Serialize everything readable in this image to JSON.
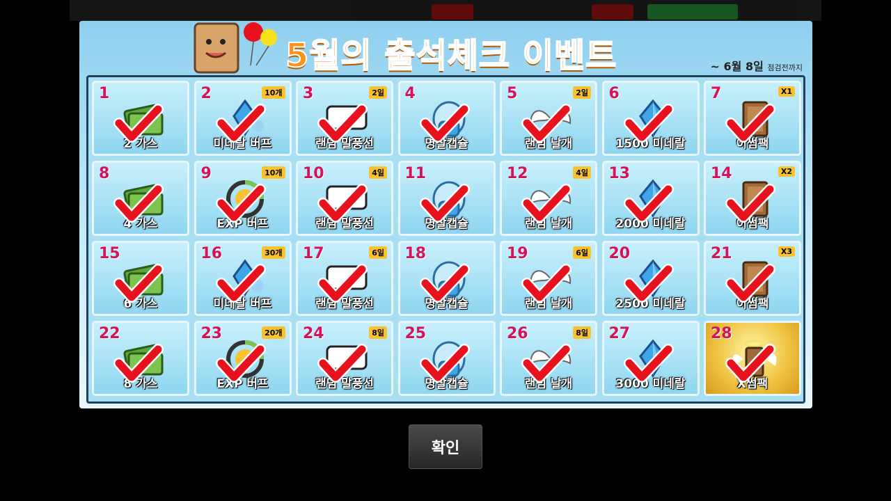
{
  "event": {
    "title": "5월의 출석체크 이벤트",
    "date": "~ 6월 8일",
    "date_suffix": "점검전까지"
  },
  "confirm_label": "확인",
  "colors": {
    "title": "#f7931e",
    "check": "#e8121f",
    "day_number": "#d4145a"
  },
  "days": [
    {
      "day": "1",
      "label": "2 가스",
      "icon": "cash-icon",
      "badge": "",
      "checked": true
    },
    {
      "day": "2",
      "label": "미네랄 버프",
      "icon": "mineral-buff-icon",
      "badge": "10개",
      "checked": true
    },
    {
      "day": "3",
      "label": "랜덤 말풍선",
      "icon": "speech-bubble-icon",
      "badge": "2일",
      "checked": true
    },
    {
      "day": "4",
      "label": "명찰캡슐",
      "icon": "capsule-icon",
      "badge": "",
      "checked": true
    },
    {
      "day": "5",
      "label": "랜덤 날개",
      "icon": "wings-icon",
      "badge": "2일",
      "checked": true
    },
    {
      "day": "6",
      "label": "1500 미네랄",
      "icon": "mineral-icon",
      "badge": "",
      "checked": true
    },
    {
      "day": "7",
      "label": "이썸팩",
      "icon": "pack-icon",
      "badge": "X1",
      "checked": true
    },
    {
      "day": "8",
      "label": "4 가스",
      "icon": "cash-icon",
      "badge": "",
      "checked": true
    },
    {
      "day": "9",
      "label": "EXP 버프",
      "icon": "exp-buff-icon",
      "badge": "10개",
      "checked": true
    },
    {
      "day": "10",
      "label": "랜덤 말풍선",
      "icon": "speech-bubble-icon",
      "badge": "4일",
      "checked": true
    },
    {
      "day": "11",
      "label": "명찰캡슐",
      "icon": "capsule-icon",
      "badge": "",
      "checked": true
    },
    {
      "day": "12",
      "label": "랜덤 날개",
      "icon": "wings-icon",
      "badge": "4일",
      "checked": true
    },
    {
      "day": "13",
      "label": "2000 미네랄",
      "icon": "mineral-icon",
      "badge": "",
      "checked": true
    },
    {
      "day": "14",
      "label": "이썸팩",
      "icon": "pack-icon",
      "badge": "X2",
      "checked": true
    },
    {
      "day": "15",
      "label": "6 가스",
      "icon": "cash-icon",
      "badge": "",
      "checked": true
    },
    {
      "day": "16",
      "label": "미네랄 버프",
      "icon": "mineral-buff-icon",
      "badge": "30개",
      "checked": true
    },
    {
      "day": "17",
      "label": "랜덤 말풍선",
      "icon": "speech-bubble-icon",
      "badge": "6일",
      "checked": true
    },
    {
      "day": "18",
      "label": "명찰캡슐",
      "icon": "capsule-icon",
      "badge": "",
      "checked": true
    },
    {
      "day": "19",
      "label": "랜덤 날개",
      "icon": "wings-icon",
      "badge": "6일",
      "checked": true
    },
    {
      "day": "20",
      "label": "2500 미네랄",
      "icon": "mineral-icon",
      "badge": "",
      "checked": true
    },
    {
      "day": "21",
      "label": "이썸팩",
      "icon": "pack-icon",
      "badge": "X3",
      "checked": true
    },
    {
      "day": "22",
      "label": "8 가스",
      "icon": "cash-icon",
      "badge": "",
      "checked": true
    },
    {
      "day": "23",
      "label": "EXP 버프",
      "icon": "exp-buff-icon",
      "badge": "20개",
      "checked": true
    },
    {
      "day": "24",
      "label": "랜덤 말풍선",
      "icon": "speech-bubble-icon",
      "badge": "8일",
      "checked": true
    },
    {
      "day": "25",
      "label": "명찰캡슐",
      "icon": "capsule-icon",
      "badge": "",
      "checked": true
    },
    {
      "day": "26",
      "label": "랜덤 날개",
      "icon": "wings-icon",
      "badge": "8일",
      "checked": true
    },
    {
      "day": "27",
      "label": "3000 미네랄",
      "icon": "mineral-icon",
      "badge": "",
      "checked": true
    },
    {
      "day": "28",
      "label": "X썸팩",
      "icon": "golden-pack-icon",
      "badge": "",
      "checked": true
    }
  ]
}
